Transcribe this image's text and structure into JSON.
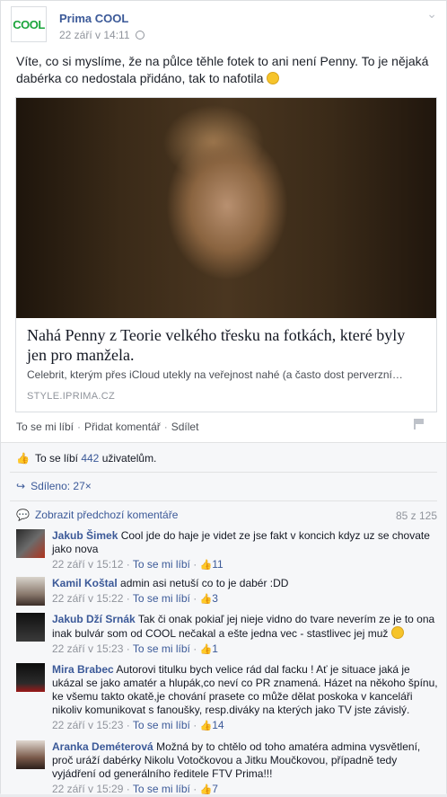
{
  "header": {
    "logo_text": "COOL",
    "page_name": "Prima COOL",
    "timestamp": "22 září v 14:11"
  },
  "post": {
    "text": "Víte, co si myslíme, že na půlce těhle fotek to ani není Penny. To je nějaká dabérka co nedostala přidáno, tak to nafotila"
  },
  "link": {
    "title": "Nahá Penny z Teorie velkého třesku na fotkách, které byly jen pro manžela.",
    "description": "Celebrit, kterým přes iCloud utekly na veřejnost nahé (a často dost perverzní…",
    "source": "STYLE.IPRIMA.CZ"
  },
  "actions": {
    "like": "To se mi líbí",
    "comment": "Přidat komentář",
    "share": "Sdílet"
  },
  "stats": {
    "likes_prefix": "To se líbí",
    "likes_count": "442",
    "likes_suffix": "uživatelům.",
    "shares": "Sdíleno: 27×",
    "prev_comments": "Zobrazit předchozí komentáře",
    "comment_count": "85 z 125"
  },
  "comments": [
    {
      "name": "Jakub Šimek",
      "text": "Cool jde do haje je videt ze jse fakt v koncich kdyz uz se chovate jako nova",
      "time": "22 září v 15:12",
      "like": "To se mi líbí",
      "likes": "11"
    },
    {
      "name": "Kamil Koštal",
      "text": "admin asi netuší co to je dabér :DD",
      "time": "22 září v 15:22",
      "like": "To se mi líbí",
      "likes": "3"
    },
    {
      "name": "Jakub Dží Srnák",
      "text": "Tak či onak pokiaľ jej nieje vidno do tvare neverím ze je to ona inak bulvár som od COOL nečakal a ešte jedna vec - stastlivec jej muž",
      "time": "22 září v 15:23",
      "like": "To se mi líbí",
      "likes": "1"
    },
    {
      "name": "Mira Brabec",
      "text": "Autorovi titulku bych velice rád dal facku ! Ať je situace jaká je ukázal se jako amatér a hlupák,co neví co PR znamená. Házet na někoho špínu, ke všemu takto okatě,je chování prasete co může dělat poskoka v kanceláři nikoliv komunikovat s fanoušky, resp.diváky na kterých jako TV jste závislý.",
      "time": "22 září v 15:23",
      "like": "To se mi líbí",
      "likes": "14"
    },
    {
      "name": "Aranka Deméterová",
      "text": "Možná by to chtělo od toho amatéra admina vysvětlení, proč uráží dabérky Nikolu Votočkovou a Jitku Moučkovou, případně tedy vyjádření od generálního ředitele FTV Prima!!!",
      "time": "22 září v 15:29",
      "like": "To se mi líbí",
      "likes": "7"
    }
  ]
}
